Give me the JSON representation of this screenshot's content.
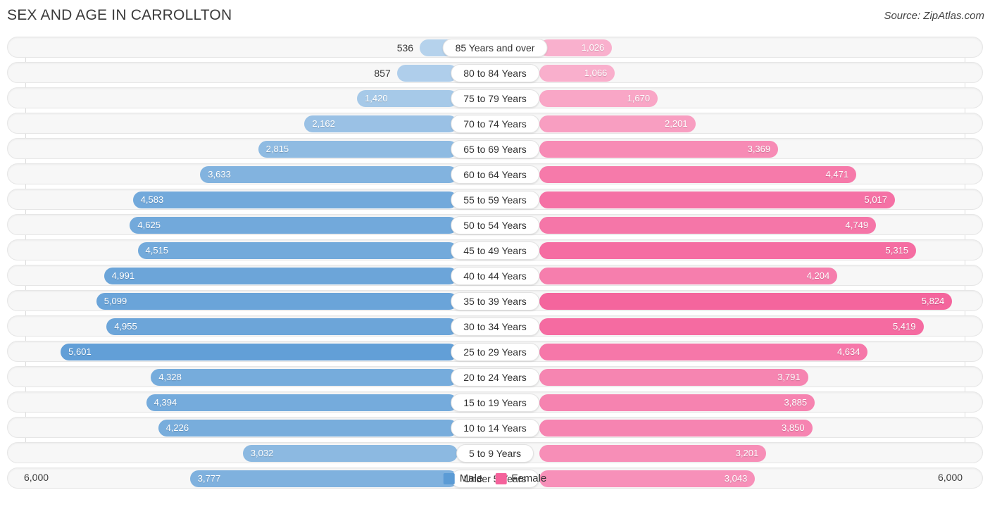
{
  "header": {
    "title": "SEX AND AGE IN CARROLLTON",
    "source": "Source: ZipAtlas.com"
  },
  "axis": {
    "left_label": "6,000",
    "right_label": "6,000"
  },
  "legend": [
    {
      "label": "Male",
      "color": "#5b9bd5"
    },
    {
      "label": "Female",
      "color": "#f4629b"
    }
  ],
  "chart_data": {
    "type": "bar",
    "title": "SEX AND AGE IN CARROLLTON",
    "subtitle": "Source: ZipAtlas.com",
    "xlabel": "",
    "ylabel": "",
    "axis_max": 6000,
    "xlim": [
      -6000,
      6000
    ],
    "grid": true,
    "legend_position": "bottom-center",
    "categories": [
      "85 Years and over",
      "80 to 84 Years",
      "75 to 79 Years",
      "70 to 74 Years",
      "65 to 69 Years",
      "60 to 64 Years",
      "55 to 59 Years",
      "50 to 54 Years",
      "45 to 49 Years",
      "40 to 44 Years",
      "35 to 39 Years",
      "30 to 34 Years",
      "25 to 29 Years",
      "20 to 24 Years",
      "15 to 19 Years",
      "10 to 14 Years",
      "5 to 9 Years",
      "Under 5 Years"
    ],
    "series": [
      {
        "name": "Male",
        "color": "#5b9bd5",
        "values": [
          536,
          857,
          1420,
          2162,
          2815,
          3633,
          4583,
          4625,
          4515,
          4991,
          5099,
          4955,
          5601,
          4328,
          4394,
          4226,
          3032,
          3777
        ],
        "labels": [
          "536",
          "857",
          "1,420",
          "2,162",
          "2,815",
          "3,633",
          "4,583",
          "4,625",
          "4,515",
          "4,991",
          "5,099",
          "4,955",
          "5,601",
          "4,328",
          "4,394",
          "4,226",
          "3,032",
          "3,777"
        ]
      },
      {
        "name": "Female",
        "color": "#f4629b",
        "values": [
          1026,
          1066,
          1670,
          2201,
          3369,
          4471,
          5017,
          4749,
          5315,
          4204,
          5824,
          5419,
          4634,
          3791,
          3885,
          3850,
          3201,
          3043
        ],
        "labels": [
          "1,026",
          "1,066",
          "1,670",
          "2,201",
          "3,369",
          "4,471",
          "5,017",
          "4,749",
          "5,315",
          "4,204",
          "5,824",
          "5,419",
          "4,634",
          "3,791",
          "3,885",
          "3,850",
          "3,201",
          "3,043"
        ]
      }
    ]
  }
}
